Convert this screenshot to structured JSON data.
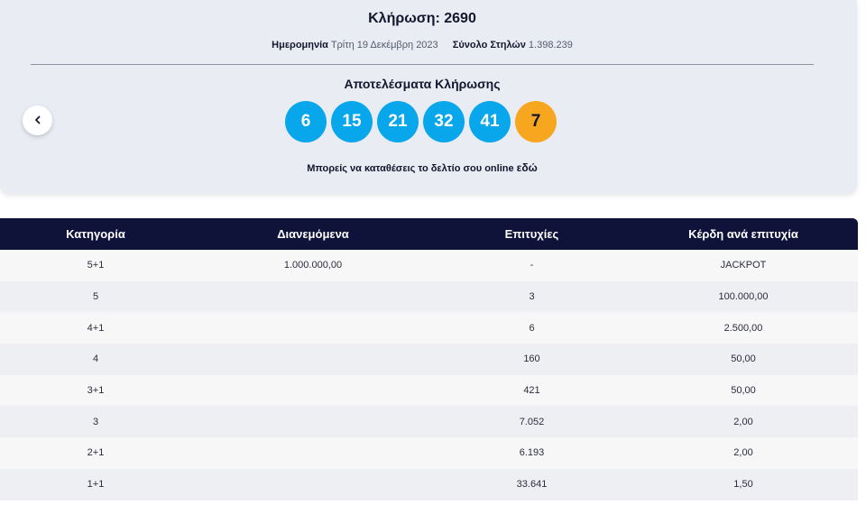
{
  "draw": {
    "title": "Κλήρωση: 2690",
    "date_label": "Ημερομηνία",
    "date_value": "Τρίτη 19 Δεκέμβρη 2023",
    "columns_label": "Σύνολο Στηλών",
    "columns_value": "1.398.239"
  },
  "results": {
    "title": "Αποτελέσματα Κλήρωσης",
    "numbers": [
      "6",
      "15",
      "21",
      "32",
      "41"
    ],
    "joker": "7"
  },
  "online": {
    "text": "Μπορείς να καταθέσεις το δελτίο σου online",
    "link": "εδώ"
  },
  "icons": {
    "prev": "chevron-left-icon"
  },
  "colors": {
    "ball": "#08a6ea",
    "joker": "#f6a71f",
    "header": "#0f1339"
  },
  "table": {
    "headers": [
      "Κατηγορία",
      "Διανεμόμενα",
      "Επιτυχίες",
      "Κέρδη ανά επιτυχία"
    ],
    "rows": [
      [
        "5+1",
        "1.000.000,00",
        "-",
        "JACKPOT"
      ],
      [
        "5",
        "",
        "3",
        "100.000,00"
      ],
      [
        "4+1",
        "",
        "6",
        "2.500,00"
      ],
      [
        "4",
        "",
        "160",
        "50,00"
      ],
      [
        "3+1",
        "",
        "421",
        "50,00"
      ],
      [
        "3",
        "",
        "7.052",
        "2,00"
      ],
      [
        "2+1",
        "",
        "6.193",
        "2,00"
      ],
      [
        "1+1",
        "",
        "33.641",
        "1,50"
      ]
    ]
  }
}
